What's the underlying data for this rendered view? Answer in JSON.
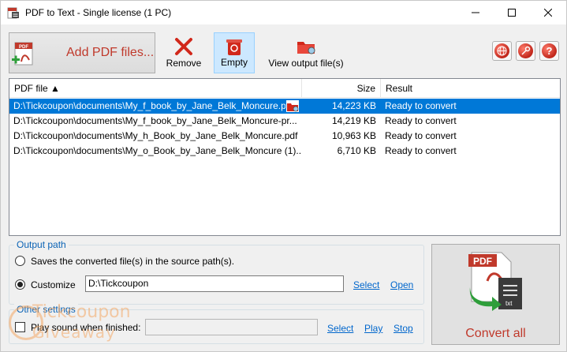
{
  "window": {
    "title": "PDF to Text - Single license (1 PC)",
    "minimize": "—",
    "maximize": "☐",
    "close": "✕"
  },
  "toolbar": {
    "add_label": "Add PDF files...",
    "remove_label": "Remove",
    "empty_label": "Empty",
    "view_label": "View output file(s)",
    "web_icon": "globe-icon",
    "key_icon": "key-icon",
    "help_label": "?"
  },
  "filelist": {
    "columns": {
      "file": "PDF file ▲",
      "size": "Size",
      "result": "Result"
    },
    "rows": [
      {
        "file": "D:\\Tickcoupon\\documents\\My_f_book_by_Jane_Belk_Moncure.pdf",
        "size": "14,223 KB",
        "result": "Ready to convert",
        "selected": true
      },
      {
        "file": "D:\\Tickcoupon\\documents\\My_f_book_by_Jane_Belk_Moncure-pr...",
        "size": "14,219 KB",
        "result": "Ready to convert",
        "selected": false
      },
      {
        "file": "D:\\Tickcoupon\\documents\\My_h_Book_by_Jane_Belk_Moncure.pdf",
        "size": "10,963 KB",
        "result": "Ready to convert",
        "selected": false
      },
      {
        "file": "D:\\Tickcoupon\\documents\\My_o_Book_by_Jane_Belk_Moncure (1)...",
        "size": "6,710 KB",
        "result": "Ready to convert",
        "selected": false
      }
    ]
  },
  "output_path": {
    "group_title": "Output path",
    "option_source": "Saves the converted file(s) in the source path(s).",
    "option_customize": "Customize",
    "path_value": "D:\\Tickcoupon",
    "select_link": "Select",
    "open_link": "Open",
    "selected_option": "customize"
  },
  "other_settings": {
    "group_title": "Other settings",
    "play_sound_label": "Play sound when finished:",
    "play_sound_checked": false,
    "sound_path": "",
    "select_link": "Select",
    "play_link": "Play",
    "stop_link": "Stop"
  },
  "convert": {
    "label": "Convert all",
    "icon_text_pdf": "PDF",
    "icon_text_txt": "txt"
  },
  "watermark": {
    "line1": "Tickcoupon",
    "line2": "Giveaway"
  },
  "colors": {
    "accent_red": "#c0392b",
    "selection_blue": "#0078d7",
    "group_title_blue": "#0b63b5",
    "link_blue": "#0066cc"
  }
}
